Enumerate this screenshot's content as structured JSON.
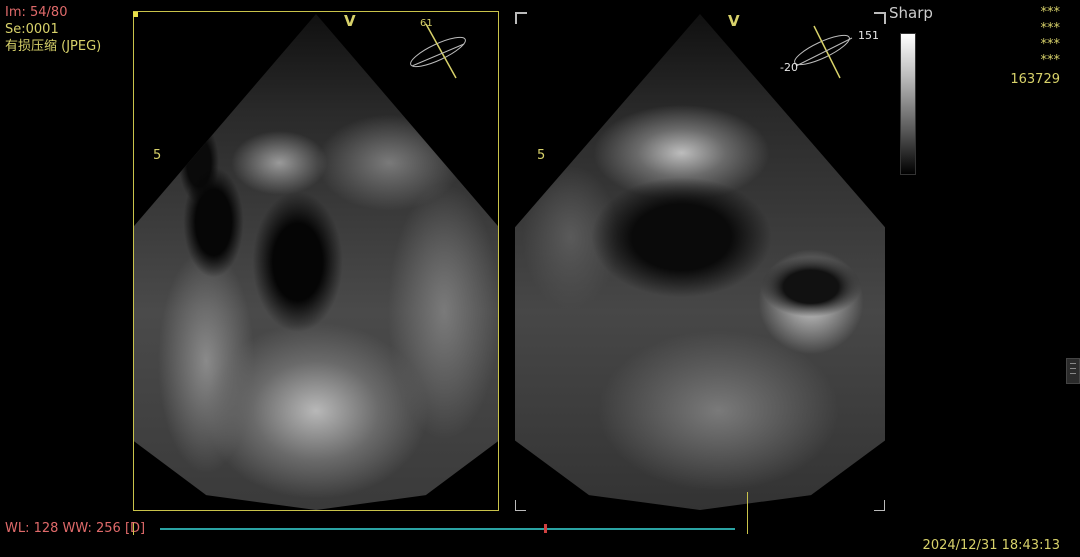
{
  "overlay": {
    "image_index": "Im: 54/80",
    "series": "Se:0001",
    "compression": "有损压缩 (JPEG)",
    "filter": "Sharp",
    "stars": [
      "***",
      "***",
      "***",
      "***"
    ],
    "id_number": "163729",
    "wl_ww": "WL: 128 WW: 256 [D]",
    "datetime": "2024/12/31 18:43:13"
  },
  "left_view": {
    "v_marker": "V",
    "depth_label": "5",
    "angle": "61"
  },
  "right_view": {
    "v_marker": "V",
    "depth_label": "5",
    "angle_top": "151",
    "angle_bottom": "-20"
  },
  "colors": {
    "red_text": "#e06a6a",
    "yellow_text": "#d8d26a",
    "timeline": "#2aa3a3"
  }
}
